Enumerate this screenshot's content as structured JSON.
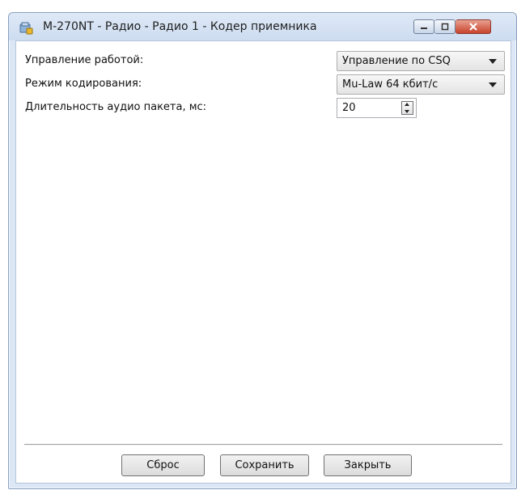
{
  "window": {
    "title": "M-270NT - Радио - Радио 1 - Кодер приемника",
    "icon": "app-icon"
  },
  "form": {
    "rows": [
      {
        "label": "Управление работой:",
        "value": "Управление по CSQ",
        "control": "dropdown"
      },
      {
        "label": "Режим кодирования:",
        "value": "Mu-Law 64 кбит/с",
        "control": "dropdown"
      },
      {
        "label": "Длительность аудио пакета, мс:",
        "value": "20",
        "control": "spinner"
      }
    ]
  },
  "buttons": {
    "reset": "Сброс",
    "save": "Сохранить",
    "close": "Закрыть"
  }
}
